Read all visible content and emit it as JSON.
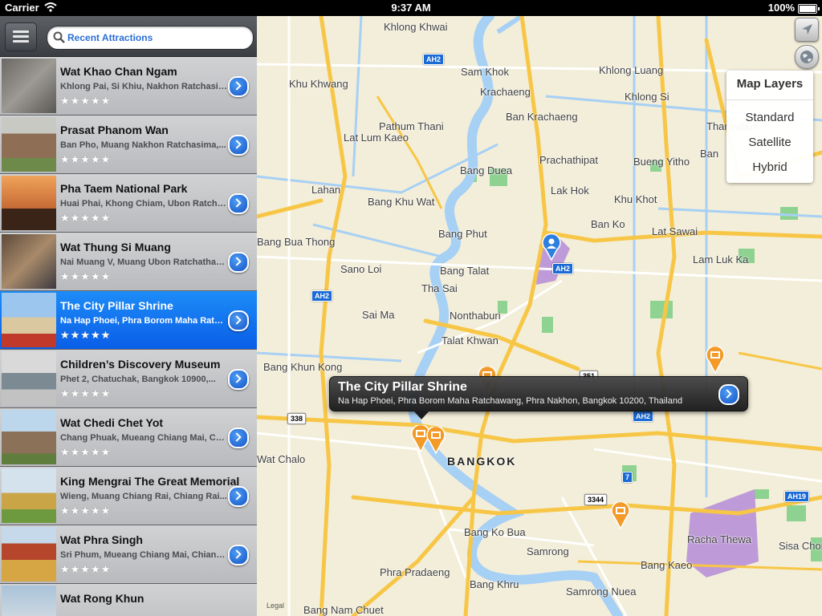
{
  "status_bar": {
    "carrier": "Carrier",
    "time": "9:37 AM",
    "battery": "100%"
  },
  "sidebar": {
    "search_text": "Recent Attractions",
    "items": [
      {
        "title": "",
        "address": "",
        "stars": "★★★★★",
        "selected": false
      },
      {
        "title": "Wat Khao Chan Ngam",
        "address": "Khlong Pai, Si Khiu, Nakhon Ratchasima,...",
        "stars": "★★★★★",
        "selected": false
      },
      {
        "title": "Prasat Phanom Wan",
        "address": "Ban Pho, Muang Nakhon Ratchasima,...",
        "stars": "★★★★★",
        "selected": false
      },
      {
        "title": "Pha Taem National Park",
        "address": "Huai Phai, Khong Chiam, Ubon Ratchathani...",
        "stars": "★★★★★",
        "selected": false
      },
      {
        "title": "Wat Thung Si Muang",
        "address": "Nai Muang V, Muang Ubon Ratchathani...",
        "stars": "★★★★★",
        "selected": false
      },
      {
        "title": "The City Pillar Shrine",
        "address": "Na Hap Phoei, Phra Borom Maha Ratchawang...",
        "stars": "★★★★★",
        "selected": true
      },
      {
        "title": "Children’s Discovery Museum",
        "address": "Phet 2, Chatuchak, Bangkok 10900,...",
        "stars": "★★★★★",
        "selected": false
      },
      {
        "title": "Wat Chedi Chet Yot",
        "address": "Chang Phuak, Mueang Chiang Mai, Chiang Mai...",
        "stars": "★★★★★",
        "selected": false
      },
      {
        "title": "King Mengrai The Great Memorial",
        "address": "Wieng, Muang Chiang Rai, Chiang Rai...",
        "stars": "★★★★★",
        "selected": false
      },
      {
        "title": "Wat Phra Singh",
        "address": "Sri Phum, Mueang Chiang Mai, Chiang Mai...",
        "stars": "★★★★★",
        "selected": false
      },
      {
        "title": "Wat Rong Khun",
        "address": "",
        "stars": "",
        "selected": false
      }
    ]
  },
  "map": {
    "city": "BANGKOK",
    "legal": "Legal",
    "labels": [
      "Khlong Khwai",
      "Sam Khok",
      "Khlong Luang",
      "Khu Khwang",
      "Krachaeng",
      "Khlong Si",
      "Ban Krachaeng",
      "Thanyaburi",
      "Pathum Thani",
      "Lat Lum Kaeo",
      "Prachathipat",
      "Bueng Yitho",
      "Ban",
      "Bang Duea",
      "Lahan",
      "Lak Hok",
      "Bang Khu Wat",
      "Khu Khot",
      "Bang Phut",
      "Ban Ko",
      "Lat Sawai",
      "Bang Talat",
      "Sano Loi",
      "Lam Luk Ka",
      "Tha Sai",
      "Sai Ma",
      "Nonthaburi",
      "Talat Khwan",
      "Bang Khun Kong",
      "Bang Ko Bua",
      "Samrong",
      "Racha Thewa",
      "Sisa Chorakhe",
      "Phra Pradaeng",
      "Bang Kaeo",
      "Bang Khru",
      "Samrong Nuea",
      "Bang Nam Chuet",
      "Bang Bua Thong",
      "Wat Chalo"
    ],
    "shields": [
      "AH2",
      "AH2",
      "AH2",
      "AH2",
      "338",
      "351",
      "3344",
      "7",
      "AH19"
    ],
    "callout": {
      "title": "The City Pillar Shrine",
      "address": "Na Hap Phoei, Phra Borom Maha Ratchawang, Phra Nakhon, Bangkok 10200, Thailand"
    },
    "layers": {
      "title": "Map Layers",
      "options": [
        "Standard",
        "Satellite",
        "Hybrid"
      ]
    }
  },
  "colors": {
    "selected_row": "#0a5ee6",
    "road_yellow": "#f7c646",
    "water": "#a7d0f5",
    "park": "#84cf8a"
  }
}
